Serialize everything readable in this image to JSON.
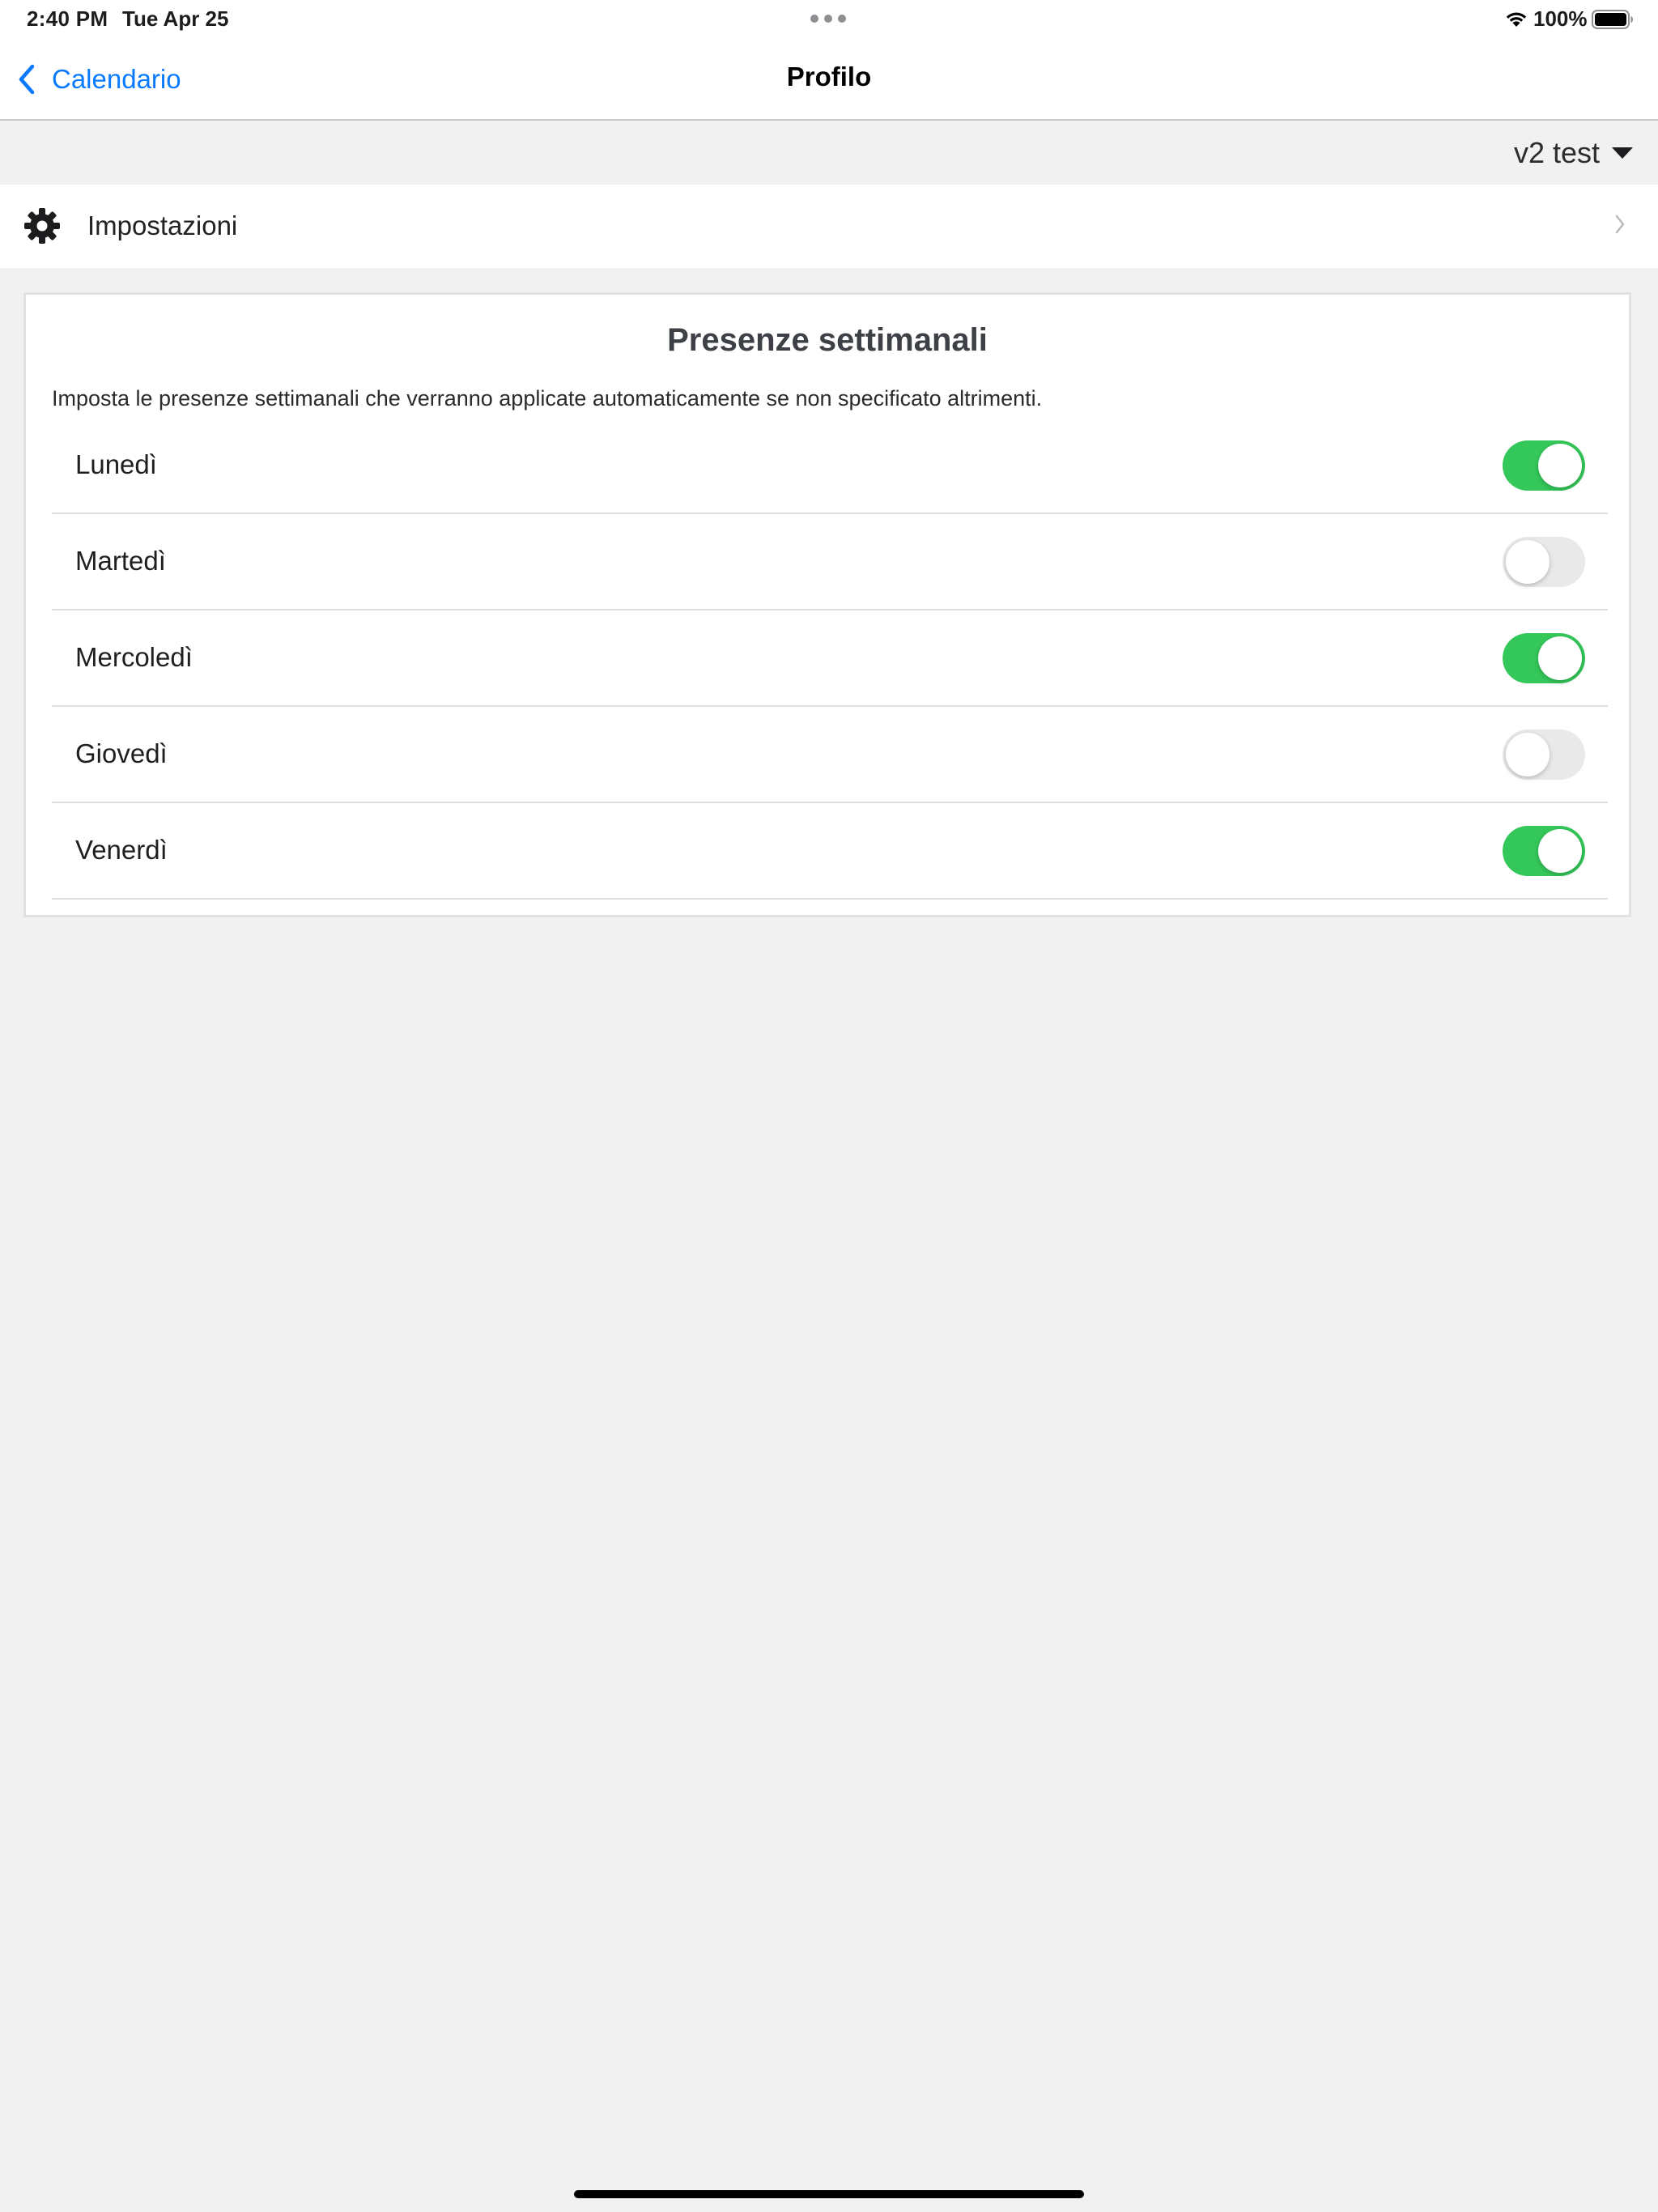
{
  "status_bar": {
    "time": "2:40 PM",
    "date": "Tue Apr 25",
    "battery": "100%"
  },
  "nav": {
    "back_label": "Calendario",
    "title": "Profilo"
  },
  "account": {
    "label": "v2 test"
  },
  "settings": {
    "label": "Impostazioni"
  },
  "weekly_presence": {
    "title": "Presenze settimanali",
    "description": "Imposta le presenze settimanali che verranno applicate automaticamente se non specificato altrimenti.",
    "days": [
      {
        "label": "Lunedì",
        "enabled": true
      },
      {
        "label": "Martedì",
        "enabled": false
      },
      {
        "label": "Mercoledì",
        "enabled": true
      },
      {
        "label": "Giovedì",
        "enabled": false
      },
      {
        "label": "Venerdì",
        "enabled": true
      }
    ]
  },
  "colors": {
    "accent": "#0a7aff",
    "toggle_on": "#34c759",
    "toggle_off": "#e9e9ea",
    "background": "#f1f1f1"
  },
  "icons": [
    "wifi-icon",
    "battery-icon",
    "back-chevron-icon",
    "caret-down-icon",
    "gear-icon",
    "chevron-right-icon"
  ]
}
